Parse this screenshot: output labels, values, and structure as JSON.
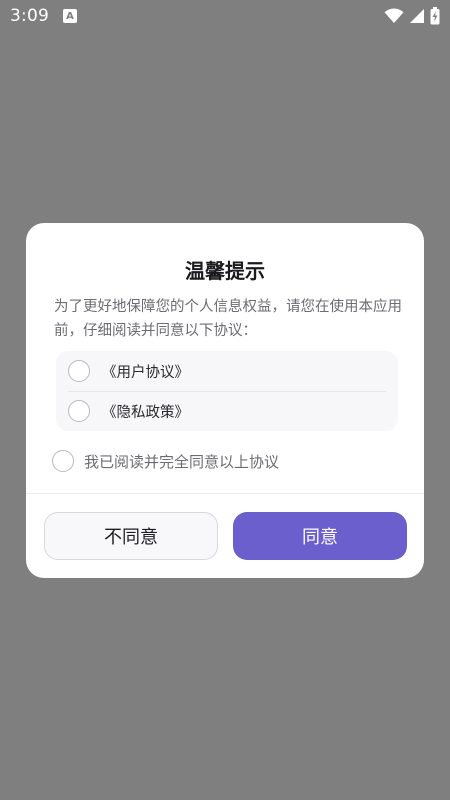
{
  "status_bar": {
    "time": "3:09",
    "notification_icon_letter": "A",
    "icons": [
      "wifi-icon",
      "signal-icon",
      "battery-charging-icon"
    ]
  },
  "dialog": {
    "title": "温馨提示",
    "message": "为了更好地保障您的个人信息权益，请您在使用本应用前，仔细阅读并同意以下协议：",
    "agreements": [
      {
        "label": "《用户协议》",
        "checked": false
      },
      {
        "label": "《隐私政策》",
        "checked": false
      }
    ],
    "consent_label": "我已阅读并完全同意以上协议",
    "consent_checked": false,
    "disagree_label": "不同意",
    "agree_label": "同意"
  },
  "colors": {
    "overlay": "#7f7f80",
    "accent": "#6b5fcd",
    "dialog_bg": "#ffffff",
    "text_primary": "#1b1b1f",
    "text_secondary": "#6c6c72"
  }
}
